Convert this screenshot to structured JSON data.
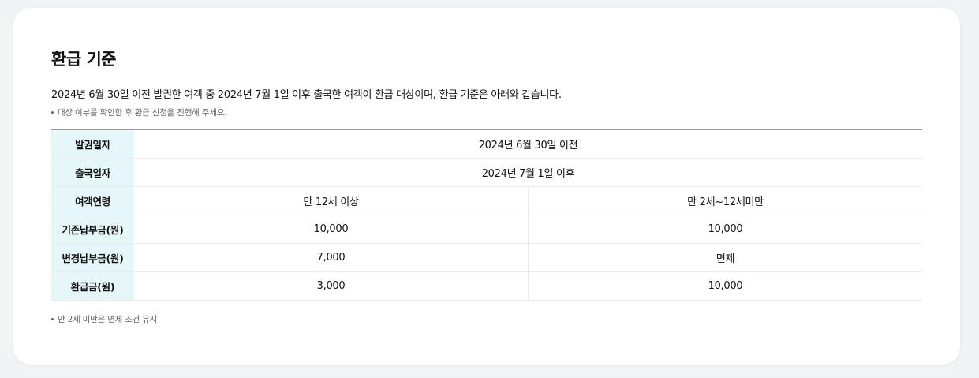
{
  "refund": {
    "title": "환급 기준",
    "description": "2024년 6월 30일 이전 발권한 여객 중 2024년 7월 1일 이후 출국한 여객이 환급 대상이며, 환급 기준은 아래와 같습니다.",
    "note_top": "대상 여부를 확인한 후 환급 신청을 진행해 주세요.",
    "note_bottom": "만 2세 미만은 면제 조건 유지",
    "table": {
      "issue_date": {
        "label": "발권일자",
        "value": "2024년 6월 30일 이전"
      },
      "departure_date": {
        "label": "출국일자",
        "value": "2024년 7월 1일 이후"
      },
      "age": {
        "label": "여객연령",
        "adult": "만 12세 이상",
        "child": "만 2세~12세미만"
      },
      "old_fee": {
        "label": "기존납부금(원)",
        "adult": "10,000",
        "child": "10,000"
      },
      "new_fee": {
        "label": "변경납부금(원)",
        "adult": "7,000",
        "child": "면제"
      },
      "refund_amount": {
        "label": "환급금(원)",
        "adult": "3,000",
        "child": "10,000"
      }
    }
  },
  "colors": {
    "page_background": "#f2f3f5",
    "card_background": "#ffffff",
    "header_cell_background": "#e5f7f8",
    "table_top_border": "#9a9a9a",
    "row_divider": "#ebebeb",
    "note_text": "#666666"
  }
}
